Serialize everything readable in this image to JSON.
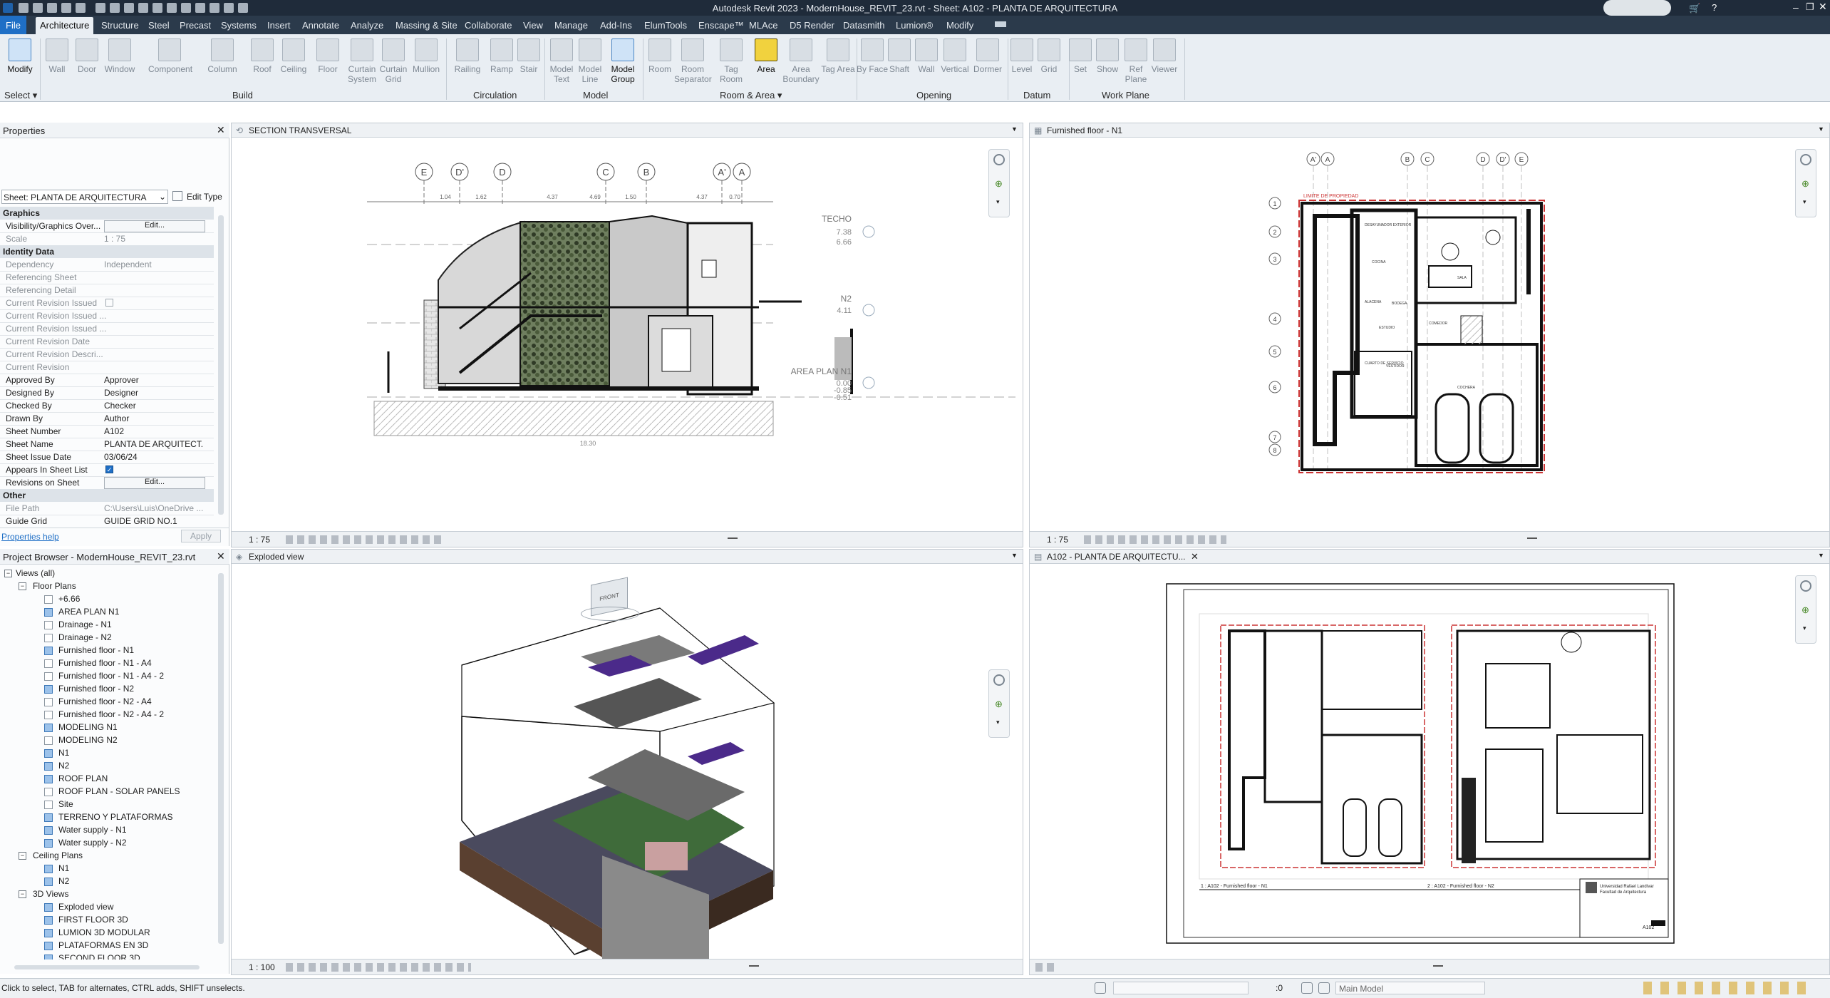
{
  "app": {
    "title": "Autodesk Revit 2023 - ModernHouse_REVIT_23.rvt - Sheet: A102 - PLANTA DE ARQUITECTURA"
  },
  "ribbon": {
    "tabs": [
      "File",
      "Architecture",
      "Structure",
      "Steel",
      "Precast",
      "Systems",
      "Insert",
      "Annotate",
      "Analyze",
      "Massing & Site",
      "Collaborate",
      "View",
      "Manage",
      "Add-Ins",
      "ElumTools",
      "Enscape™",
      "MLAce",
      "D5 Render",
      "Datasmith",
      "Lumion®",
      "Modify"
    ],
    "active_tab": "Architecture",
    "buttons": {
      "modify": "Modify",
      "wall": "Wall",
      "door": "Door",
      "window": "Window",
      "component": "Component",
      "column": "Column",
      "roof": "Roof",
      "ceiling": "Ceiling",
      "floor": "Floor",
      "curtain_system": "Curtain System",
      "curtain_grid": "Curtain Grid",
      "mullion": "Mullion",
      "railing": "Railing",
      "ramp": "Ramp",
      "stair": "Stair",
      "model_text": "Model Text",
      "model_line": "Model Line",
      "model_group": "Model Group",
      "room": "Room",
      "room_separator": "Room Separator",
      "tag_room": "Tag Room",
      "area": "Area",
      "area_boundary": "Area Boundary",
      "tag_area": "Tag Area",
      "by_face": "By Face",
      "shaft": "Shaft",
      "wall_opening": "Wall",
      "vertical": "Vertical",
      "dormer": "Dormer",
      "level": "Level",
      "grid": "Grid",
      "set": "Set",
      "show": "Show",
      "ref_plane": "Ref Plane",
      "viewer": "Viewer"
    },
    "panels": {
      "select": "Select ▾",
      "build": "Build",
      "circulation": "Circulation",
      "model": "Model",
      "room_area": "Room & Area ▾",
      "opening": "Opening",
      "datum": "Datum",
      "work_plane": "Work Plane"
    }
  },
  "properties": {
    "title": "Properties",
    "type_selector": "Sheet: PLANTA DE ARQUITECTURA",
    "edit_type": "Edit Type",
    "groups": {
      "graphics": "Graphics",
      "identity": "Identity Data",
      "other": "Other"
    },
    "rows": {
      "visibility": {
        "k": "Visibility/Graphics Over...",
        "v": "Edit..."
      },
      "scale": {
        "k": "Scale",
        "v": "1 : 75"
      },
      "dependency": {
        "k": "Dependency",
        "v": "Independent"
      },
      "ref_sheet": {
        "k": "Referencing Sheet",
        "v": ""
      },
      "ref_detail": {
        "k": "Referencing Detail",
        "v": ""
      },
      "rev_issued": {
        "k": "Current Revision Issued",
        "v": ""
      },
      "rev_issued_by": {
        "k": "Current Revision Issued ...",
        "v": ""
      },
      "rev_issued_to": {
        "k": "Current Revision Issued ...",
        "v": ""
      },
      "rev_date": {
        "k": "Current Revision Date",
        "v": ""
      },
      "rev_desc": {
        "k": "Current Revision Descri...",
        "v": ""
      },
      "rev": {
        "k": "Current Revision",
        "v": ""
      },
      "approved": {
        "k": "Approved By",
        "v": "Approver"
      },
      "designed": {
        "k": "Designed By",
        "v": "Designer"
      },
      "checked": {
        "k": "Checked By",
        "v": "Checker"
      },
      "drawn": {
        "k": "Drawn By",
        "v": "Author"
      },
      "sheet_number": {
        "k": "Sheet Number",
        "v": "A102"
      },
      "sheet_name": {
        "k": "Sheet Name",
        "v": "PLANTA DE ARQUITECT..."
      },
      "issue_date": {
        "k": "Sheet Issue Date",
        "v": "03/06/24"
      },
      "appears": {
        "k": "Appears In Sheet List",
        "v": ""
      },
      "revisions": {
        "k": "Revisions on Sheet",
        "v": "Edit..."
      },
      "file_path": {
        "k": "File Path",
        "v": "C:\\Users\\Luis\\OneDrive ..."
      },
      "guide_grid": {
        "k": "Guide Grid",
        "v": "GUIDE GRID NO.1"
      }
    },
    "help_link": "Properties help",
    "apply": "Apply"
  },
  "browser": {
    "title": "Project Browser - ModernHouse_REVIT_23.rvt",
    "root": "Views (all)",
    "floor_plans_label": "Floor Plans",
    "floor_plans": [
      "+6.66",
      "AREA PLAN N1",
      "Drainage - N1",
      "Drainage - N2",
      "Furnished floor - N1",
      "Furnished floor - N1 - A4",
      "Furnished floor - N1 - A4 - 2",
      "Furnished floor - N2",
      "Furnished floor - N2 - A4",
      "Furnished floor - N2 - A4 - 2",
      "MODELING N1",
      "MODELING N2",
      "N1",
      "N2",
      "ROOF PLAN",
      "ROOF PLAN - SOLAR PANELS",
      "Site",
      "TERRENO Y PLATAFORMAS",
      "Water supply - N1",
      "Water supply - N2"
    ],
    "ceiling_label": "Ceiling Plans",
    "ceiling_plans": [
      "N1",
      "N2"
    ],
    "views3d_label": "3D Views",
    "views3d": [
      "Exploded view",
      "FIRST FLOOR 3D",
      "LUMION 3D MODULAR",
      "PLATAFORMAS EN 3D",
      "SECOND FLOOR 3D"
    ]
  },
  "views": {
    "section": {
      "title": "SECTION TRANSVERSAL",
      "scale": "1 : 75",
      "grids": [
        "E",
        "D'",
        "D",
        "C",
        "B",
        "A'",
        "A"
      ],
      "dims": [
        "1.04",
        "1.62",
        "4.37",
        "4.69",
        "1.50",
        "4.37",
        "0.70"
      ],
      "levels": [
        {
          "name": "TECHO",
          "v1": "7.38",
          "v2": "6.66"
        },
        {
          "name": "N2",
          "v1": "4.11"
        },
        {
          "name": "AREA PLAN N1",
          "v1": "0.00",
          "v2": "-0.85",
          "v3": "-0.51"
        }
      ],
      "total": "18.30"
    },
    "floor_n1": {
      "title": "Furnished floor - N1",
      "scale": "1 : 75",
      "grids_top": [
        "A'",
        "A",
        "B",
        "C",
        "D",
        "D'",
        "E"
      ],
      "grids_left": [
        "1",
        "2",
        "3",
        "4",
        "5",
        "6",
        "7",
        "8"
      ],
      "limit_label": "LIMITE DE PROPIEDAD",
      "rooms": [
        "DESAYUNADOR EXTERIOR",
        "COCINA",
        "COMEDOR",
        "ALACENA",
        "BODEGA",
        "SALA",
        "ESTUDIO",
        "CUARTO DE SERVICIO",
        "VESTIDOR",
        "COCHERA"
      ]
    },
    "exploded": {
      "title": "Exploded view",
      "scale": "1 : 100",
      "viewcube": "FRONT"
    },
    "sheet": {
      "title": "A102 - PLANTA DE ARQUITECTU...",
      "label_left": "1 : A102 - Furnished floor - N1",
      "label_right": "2 : A102 - Furnished floor - N2",
      "university": "Universidad Rafael Landívar",
      "faculty": "Facultad de Arquitectura",
      "sheet_no": "A102"
    }
  },
  "statusbar": {
    "hint": "Click to select, TAB for alternates, CTRL adds, SHIFT unselects.",
    "model": "Main Model",
    "zero": ":0"
  },
  "colors": {
    "accent": "#1f6fc6",
    "area": "#f1d23e",
    "ribbon": "#e9eef3",
    "title": "#1f2b3a"
  }
}
